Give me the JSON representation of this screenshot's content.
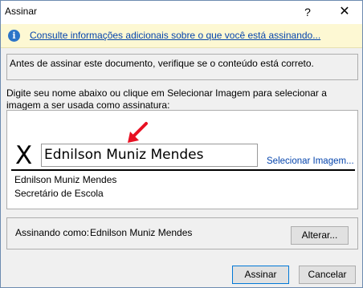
{
  "window": {
    "title": "Assinar",
    "help_glyph": "?",
    "close_glyph": "✕"
  },
  "infobar": {
    "icon": "info-icon",
    "icon_glyph": "i",
    "link_text": "Consulte informações adicionais sobre o que você está assinando..."
  },
  "notice": {
    "text": "Antes de assinar este documento, verifique se o conteúdo está correto."
  },
  "instructions": {
    "text": "Digite seu nome abaixo ou clique em Selecionar Imagem para selecionar a imagem a ser usada como assinatura:"
  },
  "signature": {
    "x_mark": "X",
    "input_value": "Ednilson Muniz Mendes",
    "select_image_label": "Selecionar Imagem...",
    "signer_name": "Ednilson Muniz Mendes",
    "signer_title": "Secretário de Escola",
    "arrow_color": "#e81123"
  },
  "signing_as": {
    "label": "Assinando como:",
    "value": "Ednilson Muniz Mendes",
    "change_button_label": "Alterar..."
  },
  "buttons": {
    "sign_label": "Assinar",
    "cancel_label": "Cancelar"
  }
}
